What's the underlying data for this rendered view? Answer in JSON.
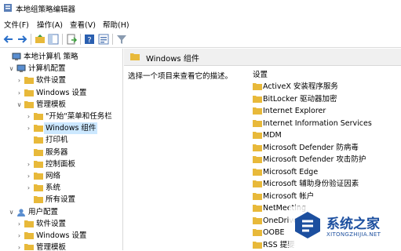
{
  "window": {
    "title": "本地组策略编辑器"
  },
  "menu": [
    "文件(F)",
    "操作(A)",
    "查看(V)",
    "帮助(H)"
  ],
  "toolbar": [
    "back-arrow-icon",
    "forward-arrow-icon",
    "folder-up-icon",
    "show-hide-tree-icon",
    "export-list-icon",
    "help-icon",
    "properties-icon",
    "filter-icon"
  ],
  "tree": [
    {
      "label": "本地计算机 策略",
      "level": 0,
      "expander": "",
      "icon": "computer-policy"
    },
    {
      "label": "计算机配置",
      "level": 1,
      "expander": "v",
      "icon": "computer"
    },
    {
      "label": "软件设置",
      "level": 2,
      "expander": ">",
      "icon": "folder"
    },
    {
      "label": "Windows 设置",
      "level": 2,
      "expander": ">",
      "icon": "folder"
    },
    {
      "label": "管理模板",
      "level": 2,
      "expander": "v",
      "icon": "folder"
    },
    {
      "label": "\"开始\"菜单和任务栏",
      "level": 3,
      "expander": ">",
      "icon": "folder"
    },
    {
      "label": "Windows 组件",
      "level": 3,
      "expander": ">",
      "icon": "folder",
      "selected": true
    },
    {
      "label": "打印机",
      "level": 3,
      "expander": "",
      "icon": "folder"
    },
    {
      "label": "服务器",
      "level": 3,
      "expander": "",
      "icon": "folder"
    },
    {
      "label": "控制面板",
      "level": 3,
      "expander": ">",
      "icon": "folder"
    },
    {
      "label": "网络",
      "level": 3,
      "expander": ">",
      "icon": "folder"
    },
    {
      "label": "系统",
      "level": 3,
      "expander": ">",
      "icon": "folder"
    },
    {
      "label": "所有设置",
      "level": 3,
      "expander": "",
      "icon": "folder"
    },
    {
      "label": "用户配置",
      "level": 1,
      "expander": "v",
      "icon": "user"
    },
    {
      "label": "软件设置",
      "level": 2,
      "expander": ">",
      "icon": "folder"
    },
    {
      "label": "Windows 设置",
      "level": 2,
      "expander": ">",
      "icon": "folder"
    },
    {
      "label": "管理模板",
      "level": 2,
      "expander": ">",
      "icon": "folder"
    }
  ],
  "right": {
    "header": "Windows 组件",
    "description": "选择一个项目来查看它的描述。",
    "column": "设置",
    "items": [
      "ActiveX 安装程序服务",
      "BitLocker 驱动器加密",
      "Internet Explorer",
      "Internet Information Services",
      "MDM",
      "Microsoft Defender 防病毒",
      "Microsoft Defender 攻击防护",
      "Microsoft Edge",
      "Microsoft 辅助身份验证因素",
      "Microsoft 帐户",
      "NetMeeting",
      "OneDrive",
      "OOBE",
      "RSS 提要"
    ]
  },
  "watermark": {
    "name": "系统之家",
    "url": "XITONGZHIJIA.NET"
  },
  "colors": {
    "folder": "#e8b93a",
    "selection": "#cce8ff",
    "brand": "#1c4f9f"
  }
}
